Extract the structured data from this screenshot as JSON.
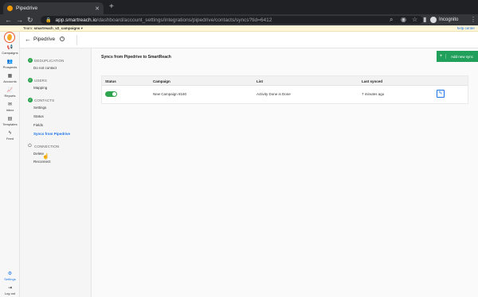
{
  "browser": {
    "tab_title": "Pipedrive",
    "url_host": "app.smartreach.io",
    "url_path": "/dashboard/account_settings/integrations/pipedrive/contacts/syncs?tid=6412",
    "profile_label": "Incognito"
  },
  "team_bar": {
    "label": "Team:",
    "team_name": "smartreach_v2_campaigns",
    "help_link": "help center"
  },
  "left_nav": {
    "items": [
      {
        "label": "Campaigns",
        "icon": "megaphone-icon"
      },
      {
        "label": "Prospects",
        "icon": "people-icon"
      },
      {
        "label": "Accounts",
        "icon": "building-icon"
      },
      {
        "label": "Reports",
        "icon": "chart-icon"
      },
      {
        "label": "Inbox",
        "icon": "inbox-icon"
      },
      {
        "label": "Templates",
        "icon": "document-icon"
      },
      {
        "label": "Feed",
        "icon": "bolt-icon"
      }
    ],
    "settings_label": "Settings",
    "logout_label": "Log out"
  },
  "header": {
    "title": "Pipedrive"
  },
  "sidebar": {
    "sections": [
      {
        "title": "DEDUPLICATION",
        "items": [
          "Do not contact"
        ]
      },
      {
        "title": "USERS",
        "items": [
          "Mapping"
        ]
      },
      {
        "title": "CONTACTS",
        "items": [
          "Settings",
          "Status",
          "Fields",
          "Syncs from Pipedrive"
        ]
      },
      {
        "title": "CONNECTION",
        "items": [
          "Delete",
          "Reconnect"
        ]
      }
    ]
  },
  "main": {
    "title": "Syncs from Pipedrive to SmartReach",
    "add_button": "Add new sync",
    "columns": [
      "Status",
      "Campaign",
      "List",
      "Last synced"
    ],
    "rows": [
      {
        "campaign": "New Campaign 8160",
        "list": "Activity Done is Done",
        "last_synced": "7 minutes ago"
      }
    ]
  },
  "colors": {
    "accent": "#1a73e8",
    "success": "#21a05b"
  }
}
